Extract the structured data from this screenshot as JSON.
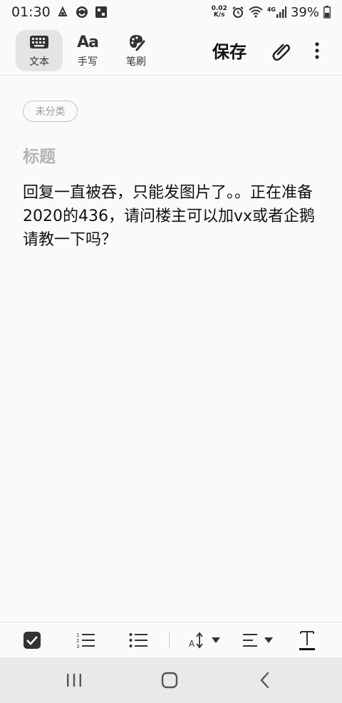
{
  "status_bar": {
    "time": "01:30",
    "net_speed_value": "0.02",
    "net_speed_unit": "K/s",
    "network_type": "4G",
    "battery_percent": "39%",
    "icons": [
      "notification-icon",
      "sync-icon",
      "gallery-icon",
      "net-speed",
      "alarm-icon",
      "wifi-icon",
      "signal-icon",
      "battery-icon"
    ]
  },
  "toolbar": {
    "modes": [
      {
        "icon": "keyboard-icon",
        "label": "文本",
        "active": true
      },
      {
        "icon": "handwriting-icon",
        "glyph": "Aa",
        "label": "手写",
        "active": false
      },
      {
        "icon": "brush-icon",
        "label": "笔刷",
        "active": false
      }
    ],
    "save_label": "保存",
    "attach_icon": "paperclip-icon",
    "more_icon": "more-vertical-icon"
  },
  "note": {
    "category": "未分类",
    "title_placeholder": "标题",
    "body": "回复一直被吞，只能发图片了。。正在准备2020的436，请问楼主可以加vx或者企鹅请教一下吗？"
  },
  "format_bar": {
    "items": [
      "checkbox-icon",
      "numbered-list-icon",
      "bullet-list-icon",
      "font-size-icon",
      "align-icon",
      "text-style-icon"
    ]
  },
  "nav_bar": {
    "items": [
      "recent-apps-icon",
      "home-icon",
      "back-icon"
    ]
  },
  "colors": {
    "background": "#fafafa",
    "toolbar_active": "#e4e4e4",
    "nav_bar": "#e9e9e9",
    "placeholder": "#b3b3b3"
  }
}
